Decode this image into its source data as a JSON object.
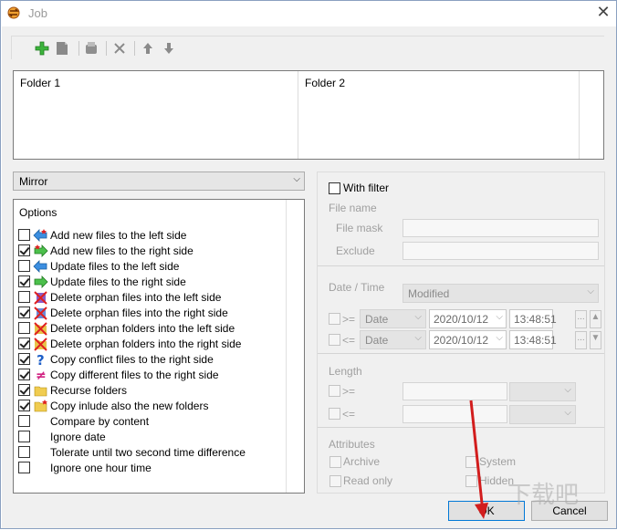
{
  "window": {
    "title": "Job"
  },
  "toolbar": {
    "buttons": [
      "add-icon",
      "edit-icon",
      "copy-icon",
      "delete-icon",
      "move-up-icon",
      "move-down-icon"
    ]
  },
  "folders": {
    "col1": "Folder 1",
    "col2": "Folder 2"
  },
  "mode": {
    "selected": "Mirror"
  },
  "options": {
    "header": "Options",
    "items": [
      {
        "label": "Add new files to the left side",
        "checked": false
      },
      {
        "label": "Add new files to the right side",
        "checked": true
      },
      {
        "label": "Update files to the left side",
        "checked": false
      },
      {
        "label": "Update files to the right side",
        "checked": true
      },
      {
        "label": "Delete orphan files into the left side",
        "checked": false
      },
      {
        "label": "Delete orphan files into the right side",
        "checked": true
      },
      {
        "label": "Delete orphan folders into the left side",
        "checked": false
      },
      {
        "label": "Delete orphan folders into the right side",
        "checked": true
      },
      {
        "label": "Copy conflict files to the right side",
        "checked": true
      },
      {
        "label": "Copy different files to the right side",
        "checked": true
      },
      {
        "label": "Recurse folders",
        "checked": true
      },
      {
        "label": "Copy inlude also the new folders",
        "checked": true
      },
      {
        "label": "Compare by content",
        "checked": false
      },
      {
        "label": "Ignore date",
        "checked": false
      },
      {
        "label": "Tolerate until two second time difference",
        "checked": false
      },
      {
        "label": "Ignore one hour time",
        "checked": false
      }
    ]
  },
  "filter": {
    "with_filter": "With filter",
    "file_name": "File name",
    "file_mask": "File mask",
    "exclude": "Exclude",
    "date_time": "Date / Time",
    "date_mode": "Modified",
    "ge": ">=",
    "le": "<=",
    "date_kind": "Date",
    "date1": "2020/10/12",
    "time1": "13:48:51",
    "date2": "2020/10/12",
    "time2": "13:48:51",
    "dots": "...",
    "length": "Length",
    "attributes": "Attributes",
    "archive": "Archive",
    "system": "System",
    "read_only": "Read only",
    "hidden": "Hidden"
  },
  "buttons": {
    "ok": "OK",
    "cancel": "Cancel"
  },
  "watermark": "下载吧"
}
